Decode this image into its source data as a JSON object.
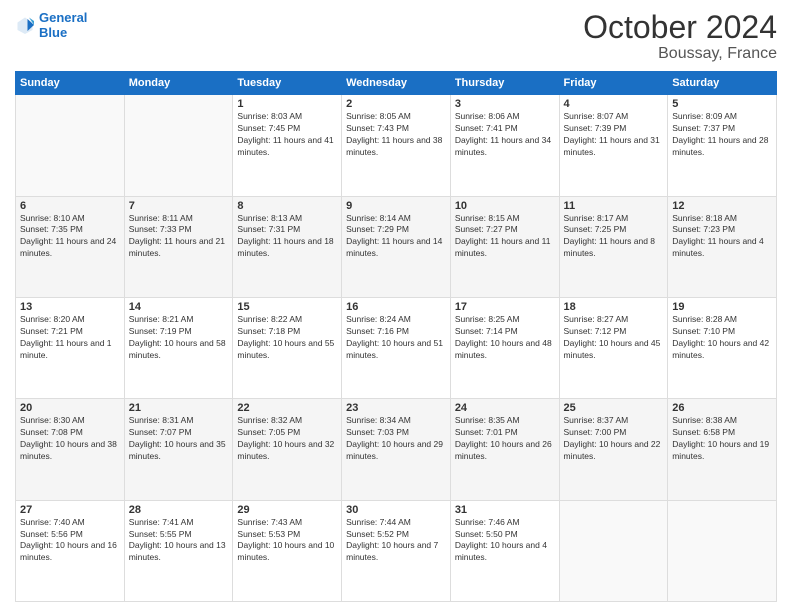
{
  "header": {
    "title": "October 2024",
    "location": "Boussay, France"
  },
  "columns": [
    "Sunday",
    "Monday",
    "Tuesday",
    "Wednesday",
    "Thursday",
    "Friday",
    "Saturday"
  ],
  "weeks": [
    [
      {
        "day": "",
        "info": ""
      },
      {
        "day": "",
        "info": ""
      },
      {
        "day": "1",
        "info": "Sunrise: 8:03 AM\nSunset: 7:45 PM\nDaylight: 11 hours and 41 minutes."
      },
      {
        "day": "2",
        "info": "Sunrise: 8:05 AM\nSunset: 7:43 PM\nDaylight: 11 hours and 38 minutes."
      },
      {
        "day": "3",
        "info": "Sunrise: 8:06 AM\nSunset: 7:41 PM\nDaylight: 11 hours and 34 minutes."
      },
      {
        "day": "4",
        "info": "Sunrise: 8:07 AM\nSunset: 7:39 PM\nDaylight: 11 hours and 31 minutes."
      },
      {
        "day": "5",
        "info": "Sunrise: 8:09 AM\nSunset: 7:37 PM\nDaylight: 11 hours and 28 minutes."
      }
    ],
    [
      {
        "day": "6",
        "info": "Sunrise: 8:10 AM\nSunset: 7:35 PM\nDaylight: 11 hours and 24 minutes."
      },
      {
        "day": "7",
        "info": "Sunrise: 8:11 AM\nSunset: 7:33 PM\nDaylight: 11 hours and 21 minutes."
      },
      {
        "day": "8",
        "info": "Sunrise: 8:13 AM\nSunset: 7:31 PM\nDaylight: 11 hours and 18 minutes."
      },
      {
        "day": "9",
        "info": "Sunrise: 8:14 AM\nSunset: 7:29 PM\nDaylight: 11 hours and 14 minutes."
      },
      {
        "day": "10",
        "info": "Sunrise: 8:15 AM\nSunset: 7:27 PM\nDaylight: 11 hours and 11 minutes."
      },
      {
        "day": "11",
        "info": "Sunrise: 8:17 AM\nSunset: 7:25 PM\nDaylight: 11 hours and 8 minutes."
      },
      {
        "day": "12",
        "info": "Sunrise: 8:18 AM\nSunset: 7:23 PM\nDaylight: 11 hours and 4 minutes."
      }
    ],
    [
      {
        "day": "13",
        "info": "Sunrise: 8:20 AM\nSunset: 7:21 PM\nDaylight: 11 hours and 1 minute."
      },
      {
        "day": "14",
        "info": "Sunrise: 8:21 AM\nSunset: 7:19 PM\nDaylight: 10 hours and 58 minutes."
      },
      {
        "day": "15",
        "info": "Sunrise: 8:22 AM\nSunset: 7:18 PM\nDaylight: 10 hours and 55 minutes."
      },
      {
        "day": "16",
        "info": "Sunrise: 8:24 AM\nSunset: 7:16 PM\nDaylight: 10 hours and 51 minutes."
      },
      {
        "day": "17",
        "info": "Sunrise: 8:25 AM\nSunset: 7:14 PM\nDaylight: 10 hours and 48 minutes."
      },
      {
        "day": "18",
        "info": "Sunrise: 8:27 AM\nSunset: 7:12 PM\nDaylight: 10 hours and 45 minutes."
      },
      {
        "day": "19",
        "info": "Sunrise: 8:28 AM\nSunset: 7:10 PM\nDaylight: 10 hours and 42 minutes."
      }
    ],
    [
      {
        "day": "20",
        "info": "Sunrise: 8:30 AM\nSunset: 7:08 PM\nDaylight: 10 hours and 38 minutes."
      },
      {
        "day": "21",
        "info": "Sunrise: 8:31 AM\nSunset: 7:07 PM\nDaylight: 10 hours and 35 minutes."
      },
      {
        "day": "22",
        "info": "Sunrise: 8:32 AM\nSunset: 7:05 PM\nDaylight: 10 hours and 32 minutes."
      },
      {
        "day": "23",
        "info": "Sunrise: 8:34 AM\nSunset: 7:03 PM\nDaylight: 10 hours and 29 minutes."
      },
      {
        "day": "24",
        "info": "Sunrise: 8:35 AM\nSunset: 7:01 PM\nDaylight: 10 hours and 26 minutes."
      },
      {
        "day": "25",
        "info": "Sunrise: 8:37 AM\nSunset: 7:00 PM\nDaylight: 10 hours and 22 minutes."
      },
      {
        "day": "26",
        "info": "Sunrise: 8:38 AM\nSunset: 6:58 PM\nDaylight: 10 hours and 19 minutes."
      }
    ],
    [
      {
        "day": "27",
        "info": "Sunrise: 7:40 AM\nSunset: 5:56 PM\nDaylight: 10 hours and 16 minutes."
      },
      {
        "day": "28",
        "info": "Sunrise: 7:41 AM\nSunset: 5:55 PM\nDaylight: 10 hours and 13 minutes."
      },
      {
        "day": "29",
        "info": "Sunrise: 7:43 AM\nSunset: 5:53 PM\nDaylight: 10 hours and 10 minutes."
      },
      {
        "day": "30",
        "info": "Sunrise: 7:44 AM\nSunset: 5:52 PM\nDaylight: 10 hours and 7 minutes."
      },
      {
        "day": "31",
        "info": "Sunrise: 7:46 AM\nSunset: 5:50 PM\nDaylight: 10 hours and 4 minutes."
      },
      {
        "day": "",
        "info": ""
      },
      {
        "day": "",
        "info": ""
      }
    ]
  ]
}
